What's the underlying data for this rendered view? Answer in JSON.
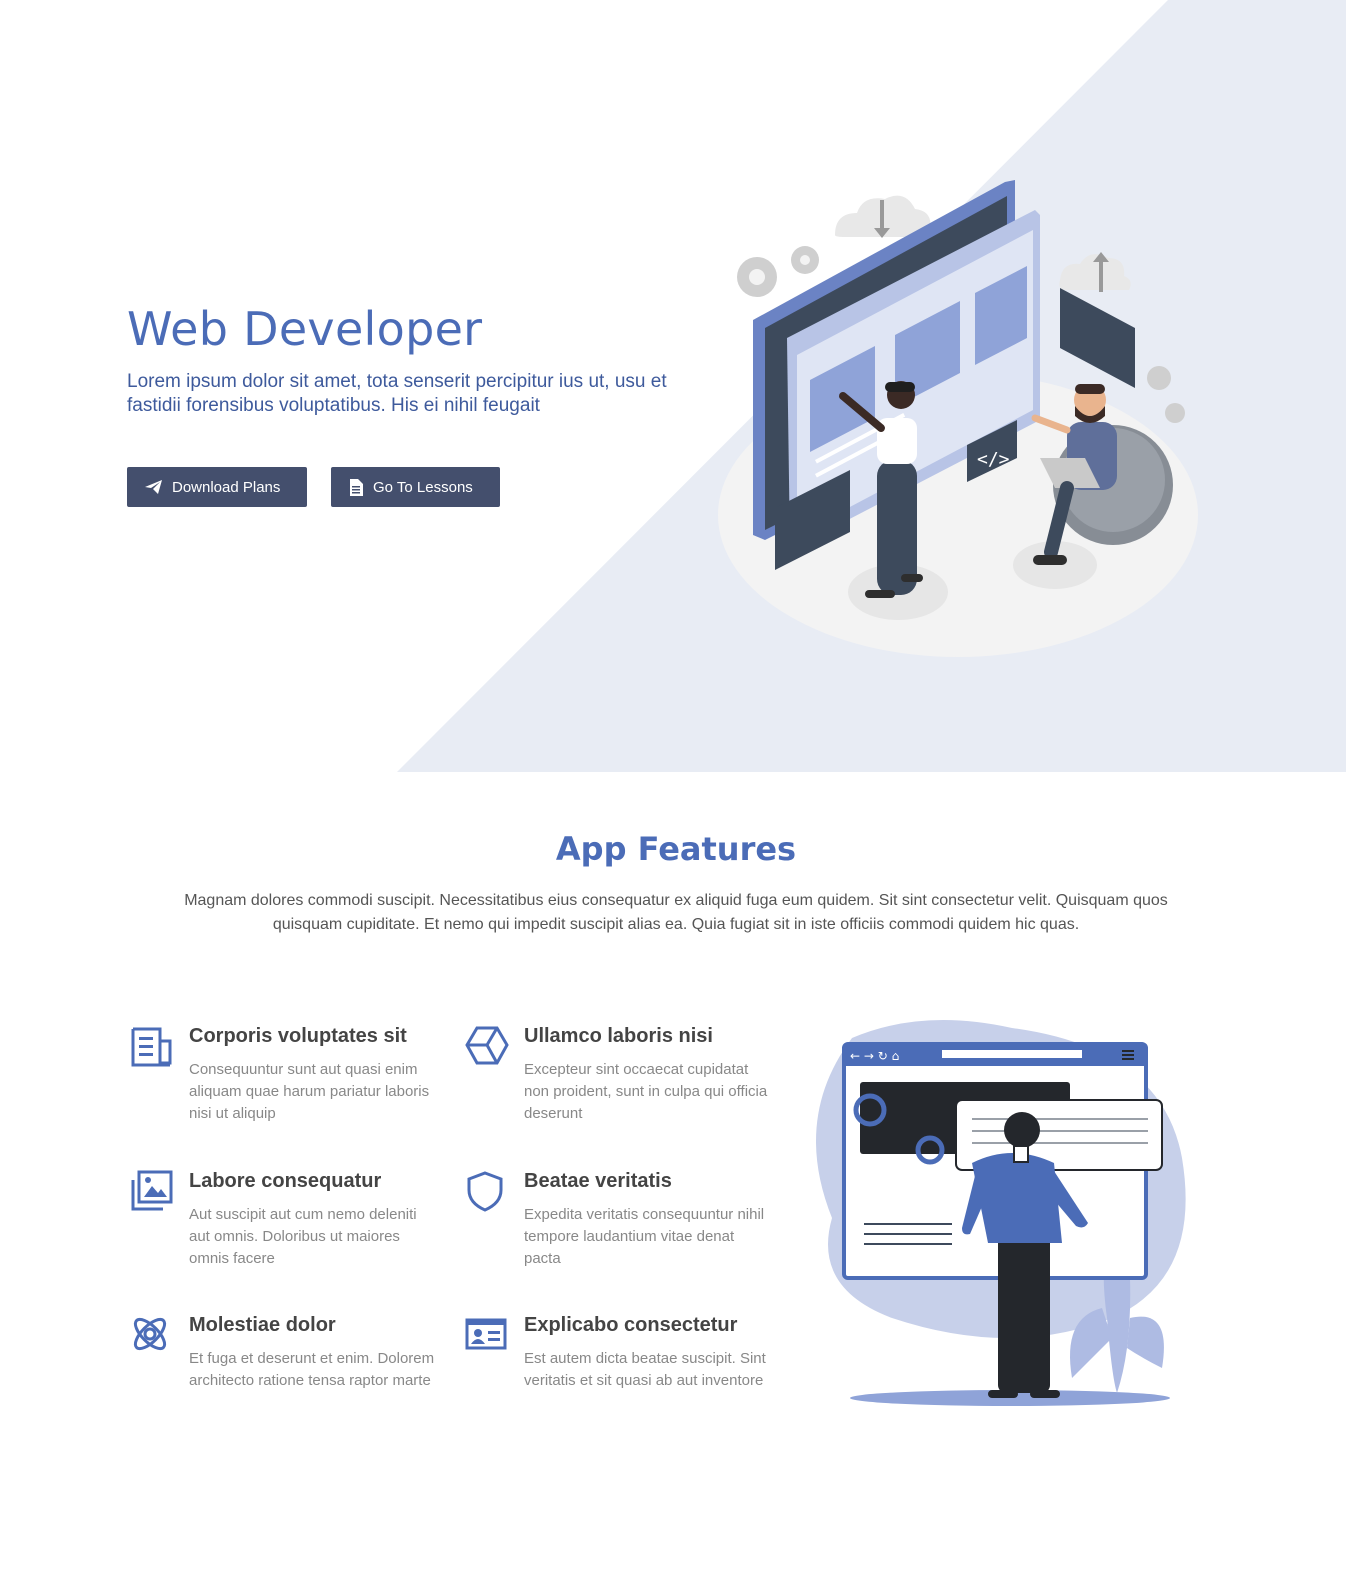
{
  "hero": {
    "title": "Web Developer",
    "subtitle": "Lorem ipsum dolor sit amet, tota senserit percipitur ius ut, usu et fastidii forensibus voluptatibus. His ei nihil feugait",
    "buttons": [
      {
        "label": "Download Plans",
        "icon": "paper-plane-icon"
      },
      {
        "label": "Go To Lessons",
        "icon": "document-icon"
      }
    ],
    "illustration": "web-developer-illustration"
  },
  "features": {
    "title": "App Features",
    "description": "Magnam dolores commodi suscipit. Necessitatibus eius consequatur ex aliquid fuga eum quidem. Sit sint consectetur velit. Quisquam quos quisquam cupiditate. Et nemo qui impedit suscipit alias ea. Quia fugiat sit in iste officiis commodi quidem hic quas.",
    "items": [
      {
        "title": "Corporis voluptates sit",
        "text": "Consequuntur sunt aut quasi enim aliquam quae harum pariatur laboris nisi ut aliquip",
        "icon": "newspaper-icon"
      },
      {
        "title": "Ullamco laboris nisi",
        "text": "Excepteur sint occaecat cupidatat non proident, sunt in culpa qui officia deserunt",
        "icon": "hexagon-box-icon"
      },
      {
        "title": "Labore consequatur",
        "text": "Aut suscipit aut cum nemo deleniti aut omnis. Doloribus ut maiores omnis facere",
        "icon": "images-icon"
      },
      {
        "title": "Beatae veritatis",
        "text": "Expedita veritatis consequuntur nihil tempore laudantium vitae denat pacta",
        "icon": "shield-icon"
      },
      {
        "title": "Molestiae dolor",
        "text": "Et fuga et deserunt et enim. Dolorem architecto ratione tensa raptor marte",
        "icon": "atom-icon"
      },
      {
        "title": "Explicabo consectetur",
        "text": "Est autem dicta beatae suscipit. Sint veritatis et sit quasi ab aut inventore",
        "icon": "id-card-icon"
      }
    ],
    "illustration": "browser-user-illustration"
  },
  "colors": {
    "accent": "#4b6cb7",
    "button": "#444f6d",
    "hero_bg": "#e8ecf4",
    "text_muted": "#888888"
  }
}
